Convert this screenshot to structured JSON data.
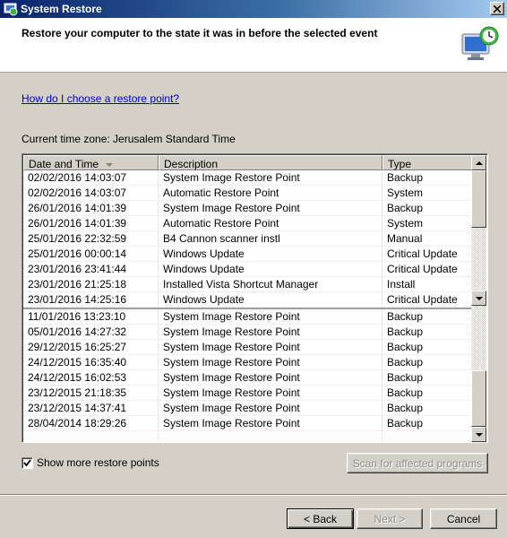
{
  "window": {
    "title": "System Restore"
  },
  "header": {
    "title": "Restore your computer to the state it was in before the selected event",
    "icon": "system-restore-icon"
  },
  "help_link": "How do I choose a restore point?",
  "timezone_label": "Current time zone: Jerusalem Standard Time",
  "table": {
    "columns": [
      "Date and Time",
      "Description",
      "Type"
    ],
    "sort_column": "Date and Time",
    "rows_top": [
      [
        "02/02/2016 14:03:07",
        "System Image Restore Point",
        "Backup"
      ],
      [
        "02/02/2016 14:03:07",
        "Automatic Restore Point",
        "System"
      ],
      [
        "26/01/2016 14:01:39",
        "System Image Restore Point",
        "Backup"
      ],
      [
        "26/01/2016 14:01:39",
        "Automatic Restore Point",
        "System"
      ],
      [
        "25/01/2016 22:32:59",
        "B4 Cannon scanner instl",
        "Manual"
      ],
      [
        "25/01/2016 00:00:14",
        "Windows Update",
        "Critical Update"
      ],
      [
        "23/01/2016 23:41:44",
        "Windows Update",
        "Critical Update"
      ],
      [
        "23/01/2016 21:25:18",
        "Installed Vista Shortcut Manager",
        "Install"
      ],
      [
        "23/01/2016 14:25:16",
        "Windows Update",
        "Critical Update"
      ]
    ],
    "rows_bottom": [
      [
        "11/01/2016 13:23:10",
        "System Image Restore Point",
        "Backup"
      ],
      [
        "05/01/2016 14:27:32",
        "System Image Restore Point",
        "Backup"
      ],
      [
        "29/12/2015 16:25:27",
        "System Image Restore Point",
        "Backup"
      ],
      [
        "24/12/2015 16:35:40",
        "System Image Restore Point",
        "Backup"
      ],
      [
        "24/12/2015 16:02:53",
        "System Image Restore Point",
        "Backup"
      ],
      [
        "23/12/2015 21:18:35",
        "System Image Restore Point",
        "Backup"
      ],
      [
        "23/12/2015 14:37:41",
        "System Image Restore Point",
        "Backup"
      ],
      [
        "28/04/2014 18:29:26",
        "System Image Restore Point",
        "Backup"
      ]
    ]
  },
  "show_more": {
    "label": "Show more restore points",
    "checked": true
  },
  "buttons": {
    "scan": "Scan for affected programs",
    "back": "< Back",
    "next": "Next >",
    "cancel": "Cancel"
  }
}
